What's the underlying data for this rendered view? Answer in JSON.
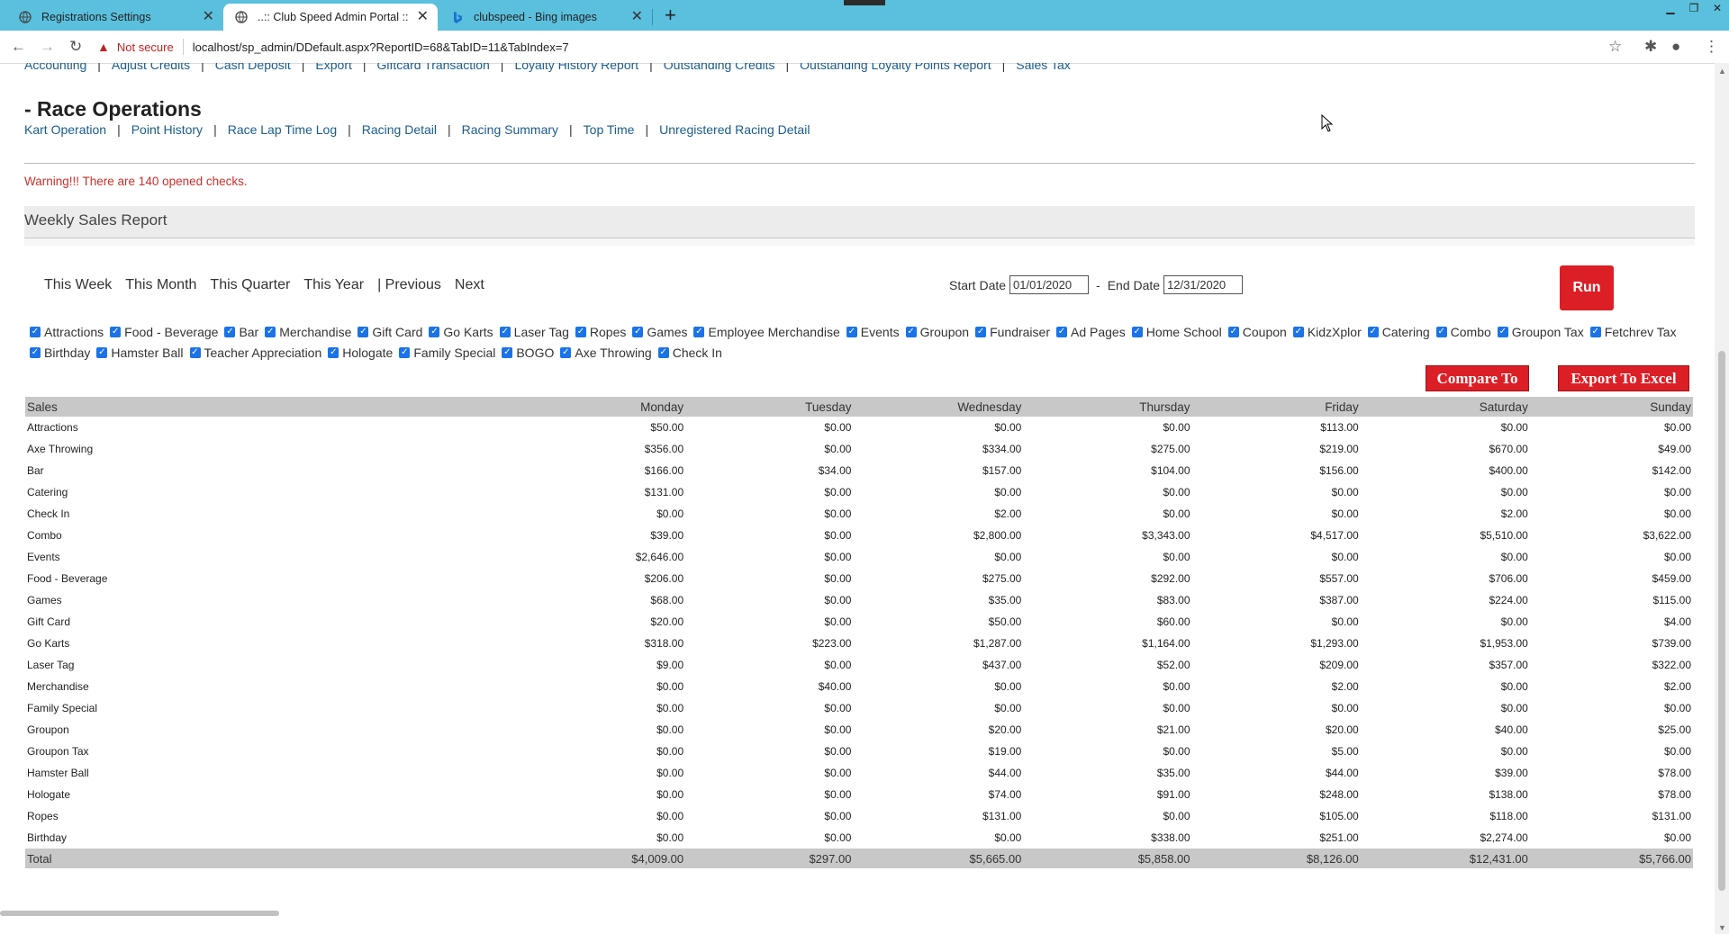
{
  "browser": {
    "tabs": [
      {
        "title": "Registrations Settings",
        "icon": "globe-icon"
      },
      {
        "title": "..:: Club Speed Admin Portal ::..",
        "icon": "globe-icon"
      },
      {
        "title": "clubspeed - Bing images",
        "icon": "bing-icon"
      }
    ],
    "address": {
      "security": "Not secure",
      "url": "localhost/sp_admin/DDefault.aspx?ReportID=68&TabID=11&TabIndex=7"
    }
  },
  "top_links": [
    "Accounting",
    "Adjust Credits",
    "Cash Deposit",
    "Export",
    "Giftcard Transaction",
    "Loyalty History Report",
    "Outstanding Credits",
    "Outstanding Loyalty Points Report",
    "Sales Tax"
  ],
  "race_operations": {
    "title": "- Race Operations",
    "links": [
      "Kart Operation",
      "Point History",
      "Race Lap Time Log",
      "Racing Detail",
      "Racing Summary",
      "Top Time",
      "Unregistered Racing Detail"
    ]
  },
  "warning": "Warning!!! There are 140 opened checks.",
  "report": {
    "title": "Weekly Sales Report",
    "periods": [
      "This Week",
      "This Month",
      "This Quarter",
      "This Year",
      "| Previous",
      "Next"
    ],
    "start_date_label": "Start Date",
    "start_date": "01/01/2020",
    "end_date_label": "End Date",
    "end_date": "12/31/2020",
    "run_label": "Run",
    "compare_label": "Compare To",
    "export_label": "Export To Excel"
  },
  "categories_checks": [
    "Attractions",
    "Food - Beverage",
    "Bar",
    "Merchandise",
    "Gift Card",
    "Go Karts",
    "Laser Tag",
    "Ropes",
    "Games",
    "Employee Merchandise",
    "Events",
    "Groupon",
    "Fundraiser",
    "Ad Pages",
    "Home School",
    "Coupon",
    "KidzXplor",
    "Catering",
    "Combo",
    "Groupon Tax",
    "Fetchrev Tax",
    "Birthday",
    "Hamster Ball",
    "Teacher Appreciation",
    "Hologate",
    "Family Special",
    "BOGO",
    "Axe Throwing",
    "Check In"
  ],
  "table": {
    "headers": [
      "Sales",
      "Monday",
      "Tuesday",
      "Wednesday",
      "Thursday",
      "Friday",
      "Saturday",
      "Sunday"
    ],
    "rows": [
      [
        "Attractions",
        "$50.00",
        "$0.00",
        "$0.00",
        "$0.00",
        "$113.00",
        "$0.00",
        "$0.00"
      ],
      [
        "Axe Throwing",
        "$356.00",
        "$0.00",
        "$334.00",
        "$275.00",
        "$219.00",
        "$670.00",
        "$49.00"
      ],
      [
        "Bar",
        "$166.00",
        "$34.00",
        "$157.00",
        "$104.00",
        "$156.00",
        "$400.00",
        "$142.00"
      ],
      [
        "Catering",
        "$131.00",
        "$0.00",
        "$0.00",
        "$0.00",
        "$0.00",
        "$0.00",
        "$0.00"
      ],
      [
        "Check In",
        "$0.00",
        "$0.00",
        "$2.00",
        "$0.00",
        "$0.00",
        "$2.00",
        "$0.00"
      ],
      [
        "Combo",
        "$39.00",
        "$0.00",
        "$2,800.00",
        "$3,343.00",
        "$4,517.00",
        "$5,510.00",
        "$3,622.00"
      ],
      [
        "Events",
        "$2,646.00",
        "$0.00",
        "$0.00",
        "$0.00",
        "$0.00",
        "$0.00",
        "$0.00"
      ],
      [
        "Food - Beverage",
        "$206.00",
        "$0.00",
        "$275.00",
        "$292.00",
        "$557.00",
        "$706.00",
        "$459.00"
      ],
      [
        "Games",
        "$68.00",
        "$0.00",
        "$35.00",
        "$83.00",
        "$387.00",
        "$224.00",
        "$115.00"
      ],
      [
        "Gift Card",
        "$20.00",
        "$0.00",
        "$50.00",
        "$60.00",
        "$0.00",
        "$0.00",
        "$4.00"
      ],
      [
        "Go Karts",
        "$318.00",
        "$223.00",
        "$1,287.00",
        "$1,164.00",
        "$1,293.00",
        "$1,953.00",
        "$739.00"
      ],
      [
        "Laser Tag",
        "$9.00",
        "$0.00",
        "$437.00",
        "$52.00",
        "$209.00",
        "$357.00",
        "$322.00"
      ],
      [
        "Merchandise",
        "$0.00",
        "$40.00",
        "$0.00",
        "$0.00",
        "$2.00",
        "$0.00",
        "$2.00"
      ],
      [
        "Family Special",
        "$0.00",
        "$0.00",
        "$0.00",
        "$0.00",
        "$0.00",
        "$0.00",
        "$0.00"
      ],
      [
        "Groupon",
        "$0.00",
        "$0.00",
        "$20.00",
        "$21.00",
        "$20.00",
        "$40.00",
        "$25.00"
      ],
      [
        "Groupon Tax",
        "$0.00",
        "$0.00",
        "$19.00",
        "$0.00",
        "$5.00",
        "$0.00",
        "$0.00"
      ],
      [
        "Hamster Ball",
        "$0.00",
        "$0.00",
        "$44.00",
        "$35.00",
        "$44.00",
        "$39.00",
        "$78.00"
      ],
      [
        "Hologate",
        "$0.00",
        "$0.00",
        "$74.00",
        "$91.00",
        "$248.00",
        "$138.00",
        "$78.00"
      ],
      [
        "Ropes",
        "$0.00",
        "$0.00",
        "$131.00",
        "$0.00",
        "$105.00",
        "$118.00",
        "$131.00"
      ],
      [
        "Birthday",
        "$0.00",
        "$0.00",
        "$0.00",
        "$338.00",
        "$251.00",
        "$2,274.00",
        "$0.00"
      ]
    ],
    "total": [
      "Total",
      "$4,009.00",
      "$297.00",
      "$5,665.00",
      "$5,858.00",
      "$8,126.00",
      "$12,431.00",
      "$5,766.00"
    ]
  }
}
